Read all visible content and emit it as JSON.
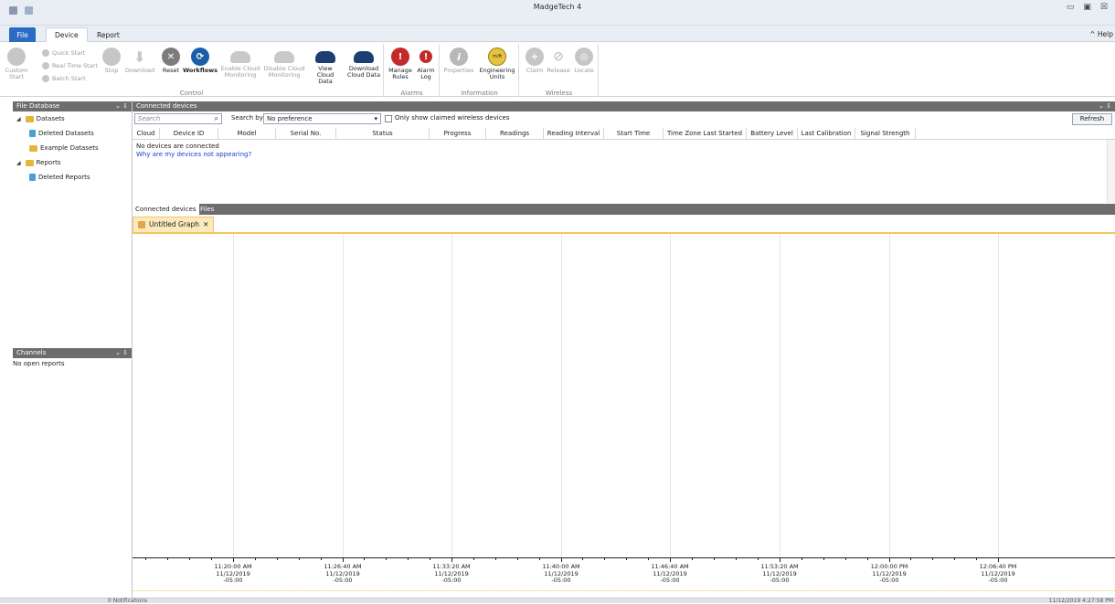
{
  "window": {
    "title": "MadgeTech 4",
    "help": "^ Help",
    "colors": {
      "accent": "#2b6bc4",
      "panel_header": "#6d6d6d",
      "graph_tab": "#f2c75c"
    }
  },
  "ribbon_tabs": {
    "file": "File",
    "device": "Device",
    "report": "Report"
  },
  "ribbon": {
    "control": {
      "label": "Control",
      "custom_start": "Custom Start",
      "quick_start": "Quick Start",
      "real_time_start": "Real Time Start",
      "batch_start": "Batch Start",
      "stop": "Stop",
      "download": "Download",
      "reset": "Reset",
      "workflows": "Workflows",
      "enable_cloud": "Enable Cloud Monitoring",
      "disable_cloud": "Disable Cloud Monitoring",
      "view_cloud": "View Cloud Data",
      "download_cloud": "Download Cloud Data"
    },
    "alarms": {
      "label": "Alarms",
      "manage_rules": "Manage Rules",
      "alarm_log": "Alarm Log"
    },
    "information": {
      "label": "Information",
      "properties": "Properties",
      "engineering_units": "Engineering Units",
      "eng_badge": "m/ft"
    },
    "wireless": {
      "label": "Wireless",
      "claim": "Claim",
      "release": "Release",
      "locate": "Locate"
    }
  },
  "file_database": {
    "title": "File Database",
    "pin": "⌄ ⇩",
    "items": [
      "Datasets",
      "Deleted Datasets",
      "Example Datasets",
      "Reports",
      "Deleted Reports"
    ]
  },
  "channels": {
    "title": "Channels",
    "pin": "⌄ ⇩",
    "empty": "No open reports"
  },
  "connected": {
    "title": "Connected devices",
    "pin": "⌄ ⇩",
    "search_placeholder": "Search",
    "search_by_label": "Search by:",
    "search_by_value": "No preference",
    "only_claimed": "Only show claimed wireless devices",
    "refresh": "Refresh",
    "columns": [
      "Cloud",
      "Device ID",
      "Model",
      "Serial No.",
      "Status",
      "Progress",
      "Readings",
      "Reading Interval",
      "Start Time",
      "Time Zone Last Started",
      "Battery Level",
      "Last Calibration",
      "Signal Strength"
    ],
    "empty": "No devices are connected",
    "why_link": "Why are my devices not appearing?"
  },
  "bottom_tabs": {
    "connected": "Connected devices",
    "files": "Files"
  },
  "graph": {
    "tab_title": "Untitled Graph",
    "close": "✕",
    "ticks": [
      {
        "time": "11:20:00 AM",
        "date": "11/12/2019",
        "tz": "-05:00"
      },
      {
        "time": "11:26:40 AM",
        "date": "11/12/2019",
        "tz": "-05:00"
      },
      {
        "time": "11:33:20 AM",
        "date": "11/12/2019",
        "tz": "-05:00"
      },
      {
        "time": "11:40:00 AM",
        "date": "11/12/2019",
        "tz": "-05:00"
      },
      {
        "time": "11:46:40 AM",
        "date": "11/12/2019",
        "tz": "-05:00"
      },
      {
        "time": "11:53:20 AM",
        "date": "11/12/2019",
        "tz": "-05:00"
      },
      {
        "time": "12:00:00 PM",
        "date": "11/12/2019",
        "tz": "-05:00"
      },
      {
        "time": "12:06:40 PM",
        "date": "11/12/2019",
        "tz": "-05:00"
      }
    ]
  },
  "status": {
    "notifications": "0 Notifications",
    "clock": "11/12/2019 4:27:58 PM"
  }
}
